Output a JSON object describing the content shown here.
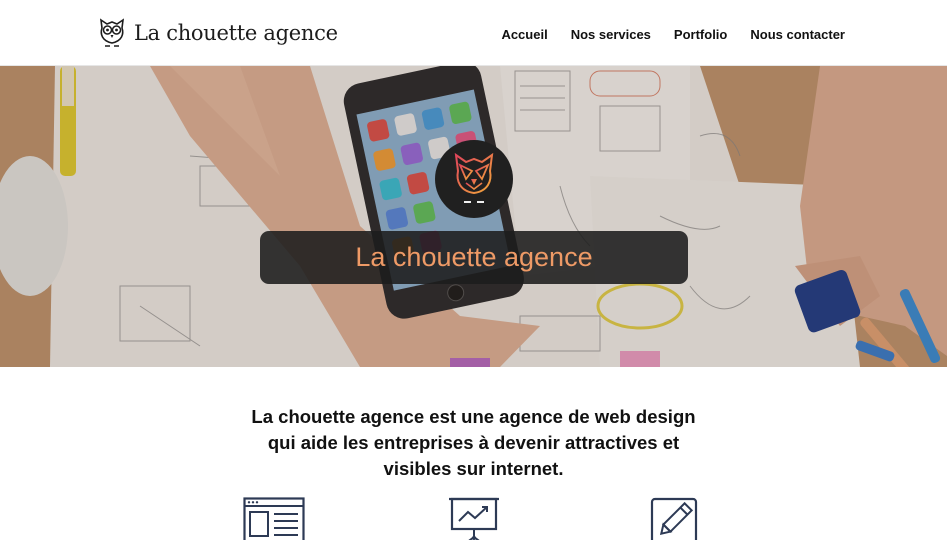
{
  "header": {
    "logo_text": "La chouette agence",
    "logo_icon": "owl-icon",
    "nav": [
      {
        "label": "Accueil"
      },
      {
        "label": "Nos services"
      },
      {
        "label": "Portfolio"
      },
      {
        "label": "Nous contacter"
      }
    ]
  },
  "hero": {
    "title": "La chouette agence",
    "badge_icon": "owl-icon",
    "title_color": "#ee9a66",
    "box_color": "#1c1c1c"
  },
  "intro": {
    "text": "La chouette agence est une agence de web design qui aide les entreprises à devenir attractives et visibles sur internet."
  },
  "services": {
    "icons": [
      "browser-layout-icon",
      "presentation-chart-icon",
      "edit-pencil-icon"
    ],
    "icon_color": "#2d3a55"
  }
}
